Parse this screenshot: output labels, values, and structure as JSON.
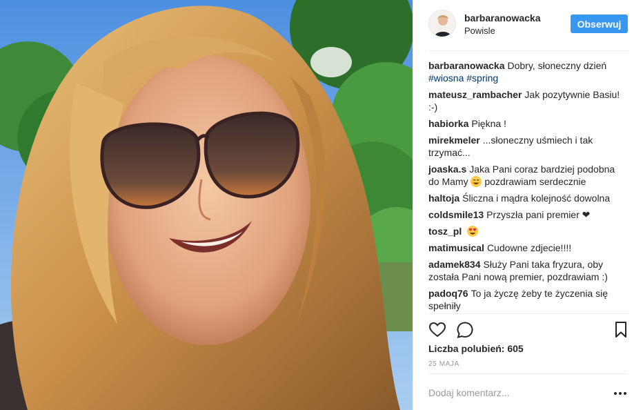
{
  "post": {
    "author": {
      "username": "barbaranowacka",
      "location": "Powisle"
    },
    "follow_label": "Obserwuj",
    "caption": {
      "username": "barbaranowacka",
      "text": "Dobry, słoneczny dzień",
      "hashtags": [
        "#wiosna",
        "#spring"
      ]
    },
    "comments": [
      {
        "user": "mateusz_rambacher",
        "text": "Jak pozytywnie Basiu! :-)"
      },
      {
        "user": "habiorka",
        "text": "Piękna !"
      },
      {
        "user": "mirekmeler",
        "text": "...słoneczny uśmiech i tak trzymać..."
      },
      {
        "user": "joaska.s",
        "text_before": "Jaka Pani coraz bardziej podobna do Mamy",
        "emoji": "smiling-face-icon",
        "text_after": "pozdrawiam serdecznie"
      },
      {
        "user": "haltoja",
        "text": "Śliczna i mądra kolejność dowolna"
      },
      {
        "user": "coldsmile13",
        "text": "Przyszła pani premier ❤"
      },
      {
        "user": "tosz_pl",
        "emoji": "heart-eyes-icon"
      },
      {
        "user": "matimusical",
        "text": "Cudowne zdjecie!!!!"
      },
      {
        "user": "adamek834",
        "text": "Służy Pani taka fryzura, oby została Pani nową premier, pozdrawiam :)"
      },
      {
        "user": "padoq76",
        "text": "To ja życzę żeby te życzenia się spełniły"
      }
    ],
    "likes_label": "Liczba polubień: 605",
    "date": "25 MAJA",
    "add_comment_placeholder": "Dodaj komentarz...",
    "colors": {
      "accent": "#3897f0",
      "hashtag": "#003569",
      "text": "#262626",
      "muted": "#999999"
    }
  }
}
